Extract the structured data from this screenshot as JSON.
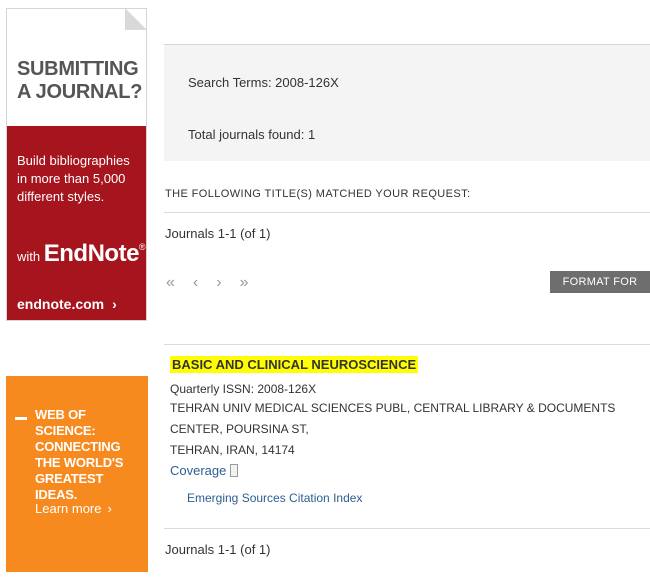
{
  "ads": {
    "endnote": {
      "headline_1": "SUBMITTING",
      "headline_2": "A JOURNAL?",
      "body_1": "Build bibliographies",
      "body_2": "in more than 5,000",
      "body_3": "different styles.",
      "with": "with",
      "brand": "EndNote",
      "reg": "®",
      "url": "endnote.com",
      "chevron": "›",
      "bg_color": "#a6141d"
    },
    "wos": {
      "line_1": "WEB OF SCIENCE:",
      "line_2": "CONNECTING",
      "line_3": "THE WORLD'S",
      "line_4": "GREATEST IDEAS.",
      "learn_more": "Learn more",
      "chevron": "›",
      "bg_color": "#f68a1f"
    }
  },
  "search": {
    "terms_label": "Search Terms: 2008-126X",
    "total_label": "Total journals found: 1"
  },
  "results": {
    "heading": "THE FOLLOWING TITLE(S) MATCHED YOUR REQUEST:",
    "range_top": "Journals 1-1 (of 1)",
    "range_bottom": "Journals 1-1 (of 1)",
    "pager": {
      "first": "«",
      "prev": "‹",
      "next": "›",
      "last": "»"
    },
    "print_button": "FORMAT FOR PRINT",
    "journal": {
      "title": "BASIC AND CLINICAL NEUROSCIENCE",
      "frequency_issn": "Quarterly ISSN: 2008-126X",
      "address_1": "TEHRAN UNIV MEDICAL SCIENCES PUBL, CENTRAL LIBRARY & DOCUMENTS CENTER, POURSINA ST,",
      "address_2": "TEHRAN, IRAN, 14174",
      "coverage_label": "Coverage",
      "coverage_icon": "document-icon",
      "index": "Emerging Sources Citation Index"
    }
  }
}
